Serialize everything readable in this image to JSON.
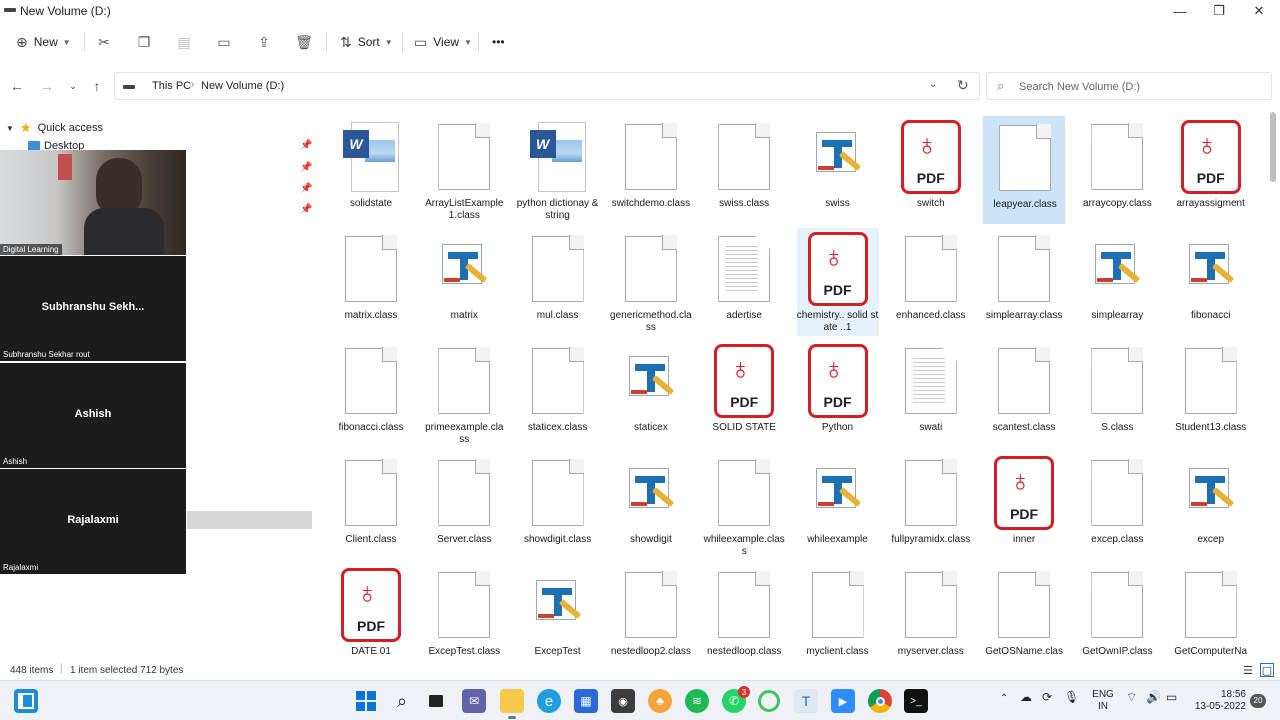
{
  "window": {
    "title": "New Volume (D:)",
    "minimize": "—",
    "maximize": "❐",
    "close": "✕"
  },
  "commandbar": {
    "new_label": "New",
    "sort_label": "Sort",
    "view_label": "View",
    "more_label": "•••"
  },
  "address": {
    "crumbs": [
      "This PC",
      "New Volume (D:)"
    ],
    "search_placeholder": "Search New Volume (D:)"
  },
  "navpane": {
    "quick_access": "Quick access",
    "desktop": "Desktop"
  },
  "meeting": {
    "tiles": [
      {
        "label": "Digital Learning",
        "big": ""
      },
      {
        "label": "Subhranshu Sekhar rout",
        "big": "Subhranshu  Sekh..."
      },
      {
        "label": "Ashish",
        "big": "Ashish"
      },
      {
        "label": "Rajalaxmi",
        "big": "Rajalaxmi"
      }
    ]
  },
  "files": [
    {
      "name": "solidstate",
      "type": "word"
    },
    {
      "name": "ArrayListExample1.class",
      "type": "file"
    },
    {
      "name": "python dictionay & string",
      "type": "word"
    },
    {
      "name": "switchdemo.class",
      "type": "file"
    },
    {
      "name": "swiss.class",
      "type": "file"
    },
    {
      "name": "swiss",
      "type": "edit"
    },
    {
      "name": "switch",
      "type": "pdf"
    },
    {
      "name": "leapyear.class",
      "type": "file",
      "selected": true
    },
    {
      "name": "arraycopy.class",
      "type": "file"
    },
    {
      "name": "arrayassigment",
      "type": "pdf"
    },
    {
      "name": "matrix.class",
      "type": "file"
    },
    {
      "name": "matrix",
      "type": "edit"
    },
    {
      "name": "mul.class",
      "type": "file"
    },
    {
      "name": "genericmethod.class",
      "type": "file"
    },
    {
      "name": "adertise",
      "type": "text"
    },
    {
      "name": "chemistry.. solid state ..1",
      "type": "pdf",
      "hovered": true
    },
    {
      "name": "enhanced.class",
      "type": "file"
    },
    {
      "name": "simplearray.class",
      "type": "file"
    },
    {
      "name": "simplearray",
      "type": "edit"
    },
    {
      "name": "fibonacci",
      "type": "edit"
    },
    {
      "name": "fibonacci.class",
      "type": "file"
    },
    {
      "name": "primeexample.class",
      "type": "file"
    },
    {
      "name": "staticex.class",
      "type": "file"
    },
    {
      "name": "staticex",
      "type": "edit"
    },
    {
      "name": "SOLID STATE",
      "type": "pdf"
    },
    {
      "name": "Python",
      "type": "pdf"
    },
    {
      "name": "swati",
      "type": "text"
    },
    {
      "name": "scantest.class",
      "type": "file"
    },
    {
      "name": "S.class",
      "type": "file"
    },
    {
      "name": "Student13.class",
      "type": "file"
    },
    {
      "name": "Client.class",
      "type": "file"
    },
    {
      "name": "Server.class",
      "type": "file"
    },
    {
      "name": "showdigit.class",
      "type": "file"
    },
    {
      "name": "showdigit",
      "type": "edit"
    },
    {
      "name": "whileexample.class",
      "type": "file"
    },
    {
      "name": "whileexample",
      "type": "edit"
    },
    {
      "name": "fullpyramidx.class",
      "type": "file"
    },
    {
      "name": "inner",
      "type": "pdf"
    },
    {
      "name": "excep.class",
      "type": "file"
    },
    {
      "name": "excep",
      "type": "edit"
    },
    {
      "name": "DATE 01",
      "type": "pdf"
    },
    {
      "name": "ExcepTest.class",
      "type": "file"
    },
    {
      "name": "ExcepTest",
      "type": "edit"
    },
    {
      "name": "nestedloop2.class",
      "type": "file"
    },
    {
      "name": "nestedloop.class",
      "type": "file"
    },
    {
      "name": "myclient.class",
      "type": "file"
    },
    {
      "name": "myserver.class",
      "type": "file"
    },
    {
      "name": "GetOSName.class",
      "type": "file"
    },
    {
      "name": "GetOwnIP.class",
      "type": "file"
    },
    {
      "name": "GetComputerNa",
      "type": "file"
    }
  ],
  "status": {
    "items": "448 items",
    "selected": "1 item selected  712 bytes"
  },
  "taskbar": {
    "lang_top": "ENG",
    "lang_bottom": "IN",
    "time": "18:56",
    "date": "13-05-2022",
    "notif": "20",
    "whatsapp_badge": "3"
  },
  "colors": {
    "pdf_red": "#d21f26",
    "selection": "#cce4f7",
    "word_blue": "#2b579a"
  }
}
